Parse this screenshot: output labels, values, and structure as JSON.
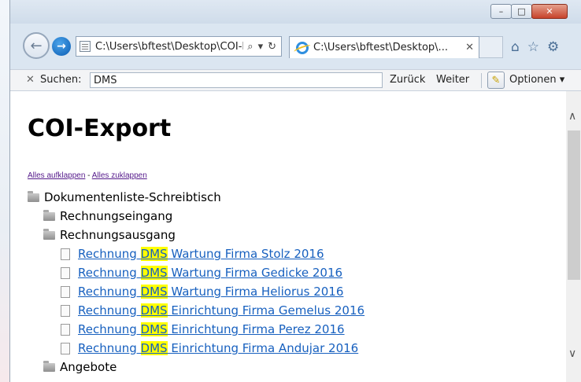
{
  "window": {
    "minimize_glyph": "–",
    "maximize_glyph": "□",
    "close_glyph": "✕"
  },
  "nav": {
    "back_glyph": "←",
    "forward_glyph": "→",
    "address": "C:\\Users\\bftest\\Desktop\\COI-Export.html",
    "search_glyph": "⌕",
    "dropdown_glyph": "▾",
    "refresh_glyph": "↻",
    "tab_title": "C:\\Users\\bftest\\Desktop\\...",
    "tab_close": "✕",
    "home_glyph": "⌂",
    "favorites_glyph": "☆",
    "settings_glyph": "⚙"
  },
  "find": {
    "close": "✕",
    "label": "Suchen:",
    "value": "DMS",
    "prev": "Zurück",
    "next": "Weiter",
    "options": "Optionen ▾"
  },
  "page": {
    "title": "COI-Export",
    "expand_all": "Alles aufklappen",
    "separator": " - ",
    "collapse_all": "Alles zuklappen",
    "tree": {
      "root": "Dokumentenliste-Schreibtisch",
      "folder_in": "Rechnungseingang",
      "folder_out": "Rechnungsausgang",
      "docs": [
        {
          "prefix": "Rechnung ",
          "highlight": "DMS",
          "suffix": " Wartung Firma Stolz 2016"
        },
        {
          "prefix": "Rechnung ",
          "highlight": "DMS",
          "suffix": " Wartung Firma Gedicke 2016"
        },
        {
          "prefix": "Rechnung ",
          "highlight": "DMS",
          "suffix": " Wartung Firma Heliorus 2016"
        },
        {
          "prefix": "Rechnung ",
          "highlight": "DMS",
          "suffix": " Einrichtung Firma Gemelus 2016"
        },
        {
          "prefix": "Rechnung ",
          "highlight": "DMS",
          "suffix": " Einrichtung Firma Perez 2016"
        },
        {
          "prefix": "Rechnung ",
          "highlight": "DMS",
          "suffix": " Einrichtung Firma Andujar 2016"
        }
      ],
      "folder_offers": "Angebote"
    }
  },
  "scroll": {
    "up_glyph": "∧",
    "down_glyph": "∨"
  }
}
